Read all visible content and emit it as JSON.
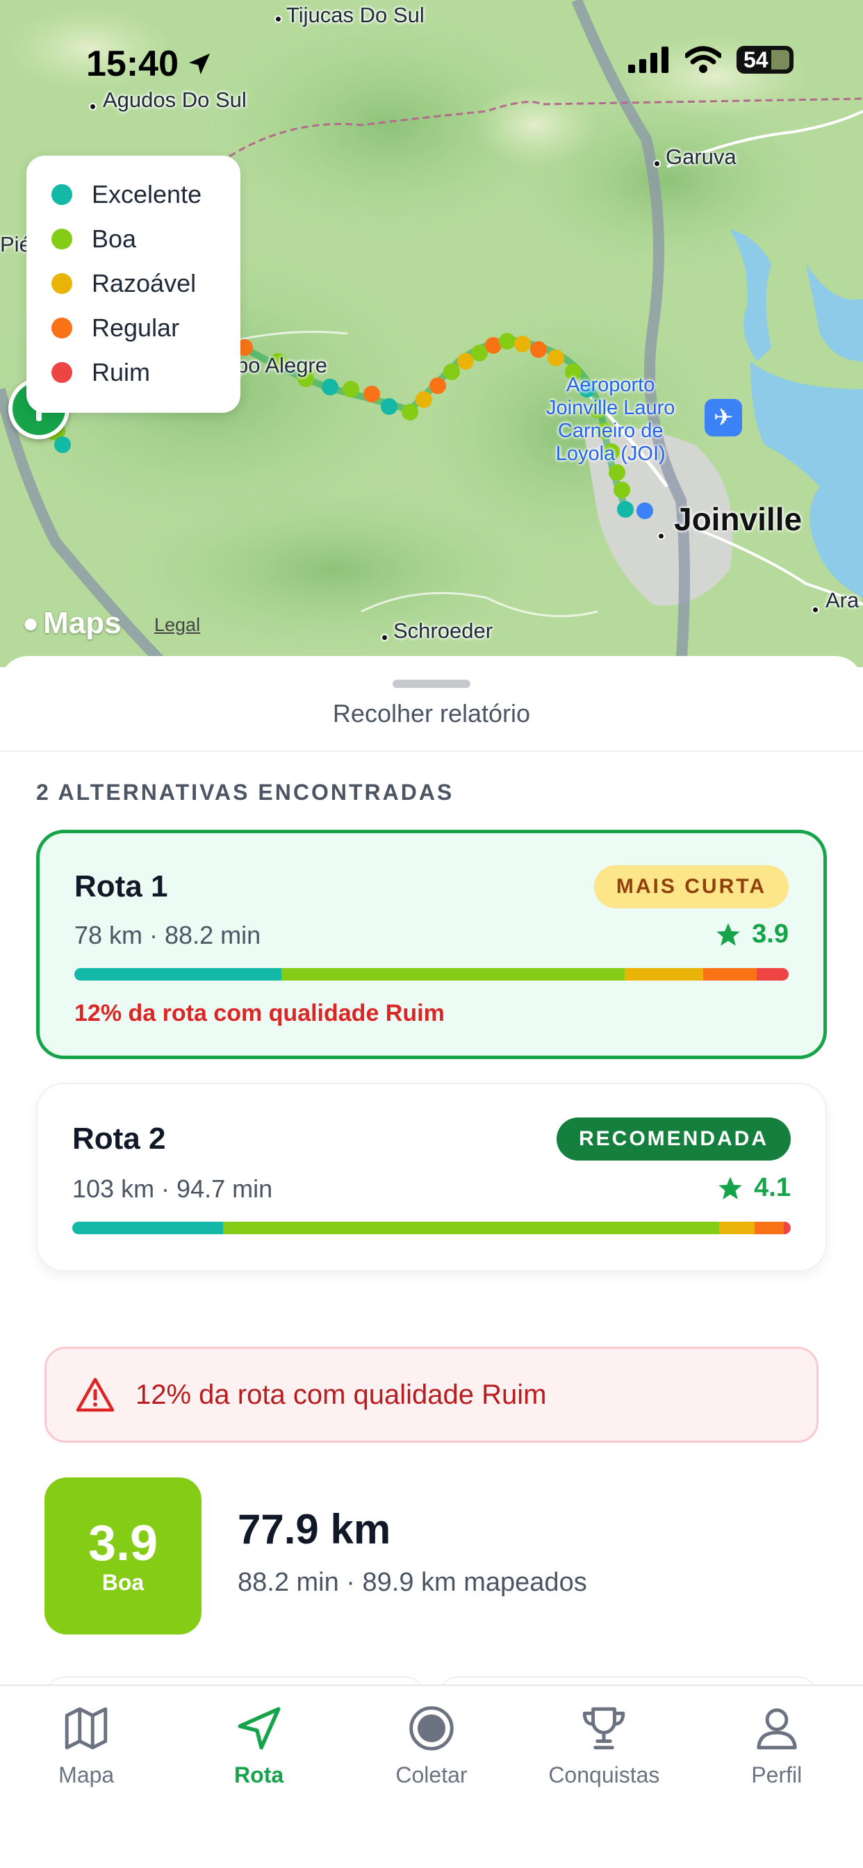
{
  "status_bar": {
    "time": "15:40",
    "battery": "54"
  },
  "map": {
    "places": {
      "tijucas": "Tijucas Do Sul",
      "agudos": "Agudos Do Sul",
      "garuva": "Garuva",
      "campo_alegre": "po Alegre",
      "airport_line1": "Aeroporto",
      "airport_line2": "Joinville Lauro",
      "airport_line3": "Carneiro de",
      "airport_line4": "Loyola (JOI)",
      "joinville": "Joinville",
      "schroeder": "Schroeder",
      "ara": "Ara",
      "pie": "Pié"
    },
    "maps_brand": "Maps",
    "legal": "Legal"
  },
  "legend": [
    {
      "label": "Excelente",
      "color": "#14b8a6"
    },
    {
      "label": "Boa",
      "color": "#84cc16"
    },
    {
      "label": "Razoável",
      "color": "#eab308"
    },
    {
      "label": "Regular",
      "color": "#f97316"
    },
    {
      "label": "Ruim",
      "color": "#ef4444"
    }
  ],
  "sheet": {
    "collapse_label": "Recolher relatório",
    "section_title": "2 ALTERNATIVAS ENCONTRADAS",
    "routes": [
      {
        "title": "Rota 1",
        "badge": "MAIS CURTA",
        "subtitle": "78 km · 88.2 min",
        "score": "3.9",
        "quality_share": [
          0.29,
          0.48,
          0.11,
          0.075,
          0.045
        ],
        "warning": "12% da rota com qualidade Ruim"
      },
      {
        "title": "Rota 2",
        "badge": "RECOMENDADA",
        "subtitle": "103 km · 94.7 min",
        "score": "4.1",
        "quality_share": [
          0.21,
          0.69,
          0.05,
          0.04,
          0.01
        ]
      }
    ],
    "alert_text": "12% da rota com qualidade Ruim",
    "summary": {
      "score": "3.9",
      "quality": "Boa",
      "distance": "77.9 km",
      "details": "88.2 min · 89.9 km mapeados"
    }
  },
  "tabbar": [
    {
      "label": "Mapa",
      "icon": "map-icon",
      "active": false
    },
    {
      "label": "Rota",
      "icon": "navigation-arrow-icon",
      "active": true
    },
    {
      "label": "Coletar",
      "icon": "record-icon",
      "active": false
    },
    {
      "label": "Conquistas",
      "icon": "trophy-icon",
      "active": false
    },
    {
      "label": "Perfil",
      "icon": "person-icon",
      "active": false
    }
  ],
  "colors": {
    "accent": "#16a34a",
    "danger": "#dc2626",
    "badge_yellow": "#fde68a",
    "badge_green": "#15803d"
  }
}
